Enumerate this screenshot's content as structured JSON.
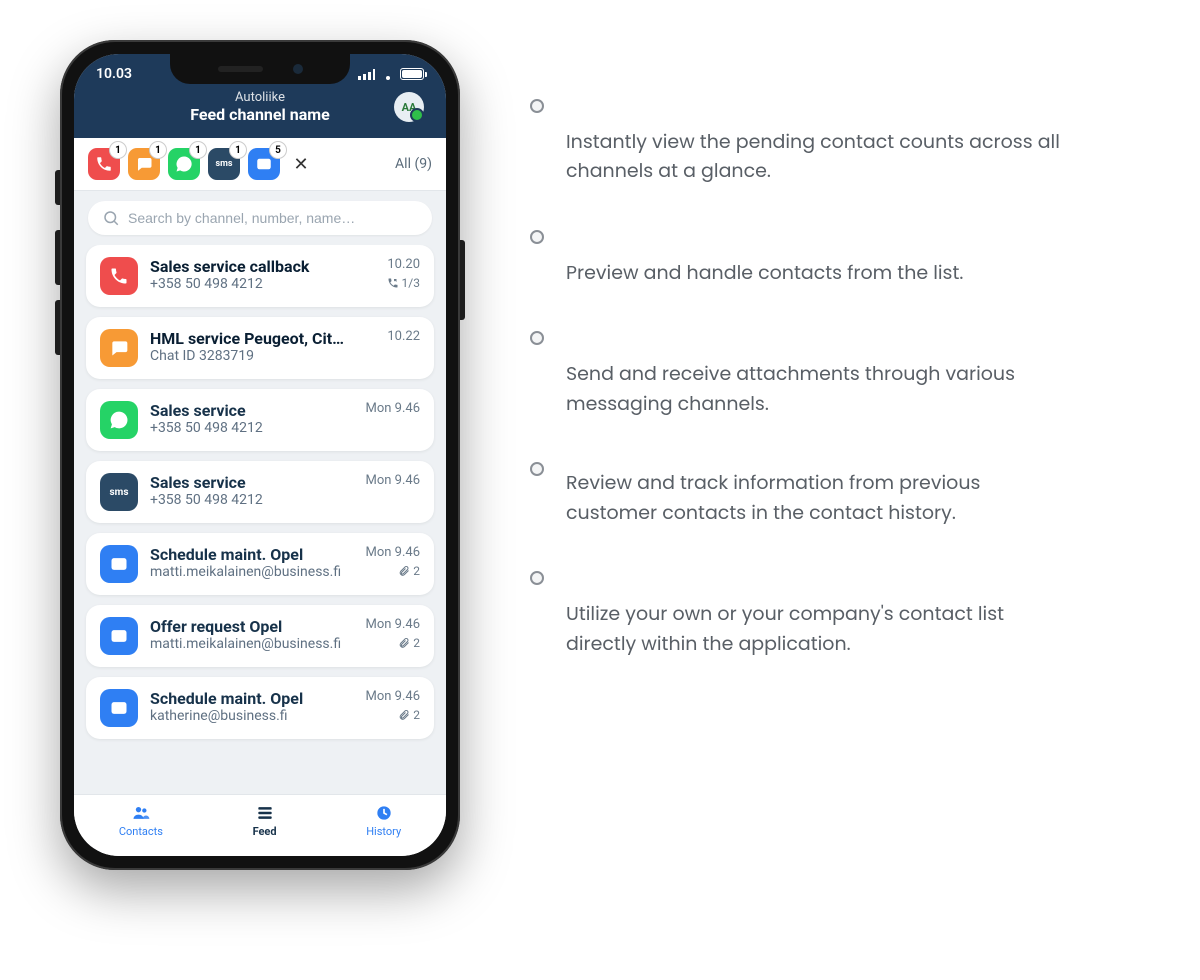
{
  "status": {
    "time": "10.03"
  },
  "header": {
    "org": "Autoliike",
    "feed": "Feed channel name",
    "avatar": "AA"
  },
  "channels": {
    "items": [
      {
        "type": "phone",
        "badge": "1"
      },
      {
        "type": "chat",
        "badge": "1"
      },
      {
        "type": "whatsapp",
        "badge": "1"
      },
      {
        "type": "sms",
        "badge": "1",
        "label": "sms"
      },
      {
        "type": "email",
        "badge": "5"
      }
    ],
    "close": "✕",
    "all_label": "All (9)"
  },
  "search": {
    "placeholder": "Search by channel, number, name…"
  },
  "feed": [
    {
      "channel": "phone",
      "title": "Sales service callback",
      "sub": "+358 50 498 4212",
      "time": "10.20",
      "meta": "1/3",
      "meta_icon": "callback",
      "unread": true
    },
    {
      "channel": "chat",
      "title": "HML service Peugeot, Cit…",
      "sub": "Chat ID 3283719",
      "time": "10.22",
      "unread": true
    },
    {
      "channel": "whatsapp",
      "title": "Sales service",
      "sub": "+358 50 498 4212",
      "time": "Mon 9.46"
    },
    {
      "channel": "sms",
      "title": "Sales service",
      "sub": "+358 50 498 4212",
      "time": "Mon 9.46"
    },
    {
      "channel": "email",
      "title": "Schedule maint. Opel",
      "sub": "matti.meikalainen@business.fi",
      "time": "Mon 9.46",
      "meta": "2",
      "meta_icon": "attachment"
    },
    {
      "channel": "email",
      "title": "Offer request Opel",
      "sub": "matti.meikalainen@business.fi",
      "time": "Mon 9.46",
      "meta": "2",
      "meta_icon": "attachment"
    },
    {
      "channel": "email",
      "title": "Schedule maint. Opel",
      "sub": "katherine@business.fi",
      "time": "Mon 9.46",
      "meta": "2",
      "meta_icon": "attachment"
    }
  ],
  "tabs": {
    "contacts": "Contacts",
    "feed": "Feed",
    "history": "History"
  },
  "features": [
    "Instantly view the pending contact counts across all channels at a glance.",
    "Preview and handle contacts from the list.",
    "Send and receive attachments through various messaging channels.",
    "Review and track information from previous customer contacts in the contact history.",
    "Utilize your own or your company's contact list directly within the application."
  ],
  "channel_colors": {
    "phone": "#ef4d4d",
    "chat": "#f79a35",
    "whatsapp": "#25d366",
    "sms": "#2b4a66",
    "email": "#2f7ff3"
  }
}
